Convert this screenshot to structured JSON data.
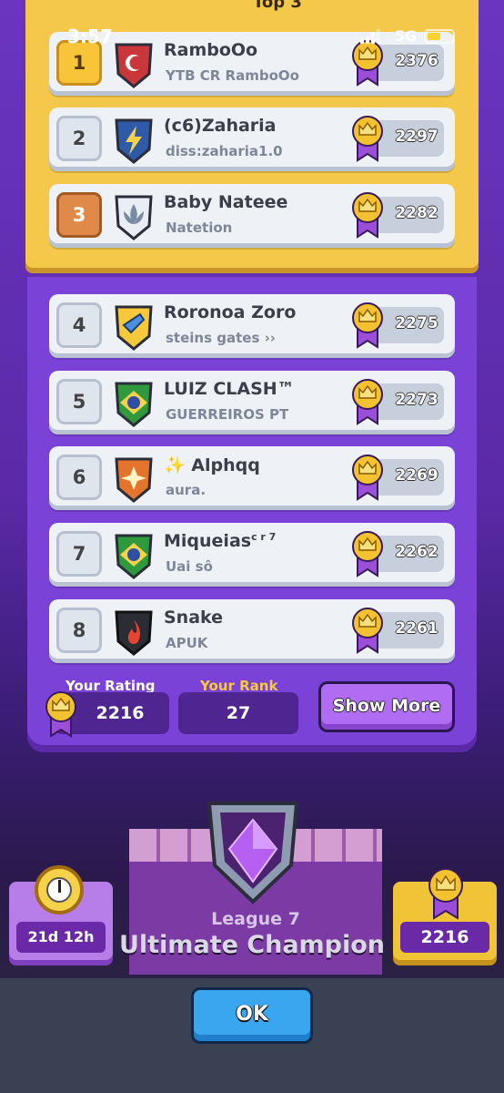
{
  "status_bar": {
    "time": "3:57",
    "network": "5G"
  },
  "section_title": "Top 3",
  "players": [
    {
      "rank": "1",
      "name": "RamboOo",
      "clan": "YTB CR RamboOo",
      "trophies": "2376",
      "badge": "crescent-flag-badge"
    },
    {
      "rank": "2",
      "name": "(c6)Zaharia",
      "clan": "diss:zaharia1.0",
      "trophies": "2297",
      "badge": "lightning-badge"
    },
    {
      "rank": "3",
      "name": "Baby Nateee",
      "clan": "Natetion",
      "trophies": "2282",
      "badge": "lotus-badge"
    },
    {
      "rank": "4",
      "name": "Roronoa Zoro",
      "clan": "steins gates ››",
      "trophies": "2275",
      "badge": "arrow-badge"
    },
    {
      "rank": "5",
      "name": "LUIZ CLASH™",
      "clan": "GUERREIROS PT",
      "trophies": "2273",
      "badge": "brazil-flag-badge"
    },
    {
      "rank": "6",
      "name": "Alphqq",
      "name_prefix": "✨",
      "clan": "aura.",
      "trophies": "2269",
      "badge": "star-badge"
    },
    {
      "rank": "7",
      "name": "Miqueias",
      "name_suffix": "c r 7",
      "clan": "Uai sô",
      "trophies": "2262",
      "badge": "brazil-flag-badge"
    },
    {
      "rank": "8",
      "name": "Snake",
      "clan": "APUK",
      "trophies": "2261",
      "badge": "flame-badge"
    }
  ],
  "your_rating": {
    "label": "Your Rating",
    "value": "2216"
  },
  "your_rank": {
    "label": "Your Rank",
    "value": "27"
  },
  "show_more_label": "Show More",
  "league": {
    "number_label": "League 7",
    "name": "Ultimate Champion"
  },
  "season_timer": "21d 12h",
  "player_trophies": "2216",
  "ok_label": "OK",
  "colors": {
    "gold": "#f4c84a",
    "purple": "#7b42d8",
    "ok_blue": "#3aa6f0",
    "your_rank_label": "#f7c843"
  }
}
